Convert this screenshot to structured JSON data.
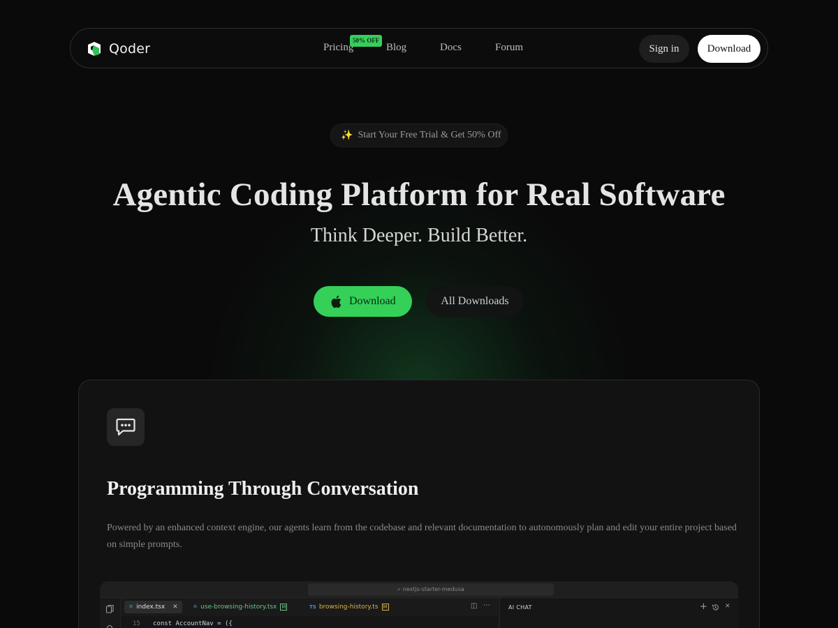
{
  "nav": {
    "brand": "Qoder",
    "links": [
      "Pricing",
      "Blog",
      "Docs",
      "Forum"
    ],
    "pricing_badge": "50% OFF",
    "sign_in": "Sign in",
    "download": "Download"
  },
  "hero": {
    "trial_text": "Start Your Free Trial & Get 50% Off",
    "title": "Agentic Coding Platform for Real Software",
    "subtitle": "Think Deeper. Build Better.",
    "cta_download": "Download",
    "all_downloads": "All Downloads"
  },
  "feature": {
    "icon": "chat-bubble-icon",
    "title": "Programming Through Conversation",
    "description": "Powered by an enhanced context engine, our agents learn from the codebase and relevant documentation to autonomously plan and edit your entire project based on simple prompts."
  },
  "editor": {
    "search": "nextjs-starter-medusa",
    "tabs": [
      {
        "label": "index.tsx",
        "active": true,
        "type": "tsx"
      },
      {
        "label": "use-browsing-history.tsx",
        "active": false,
        "type": "tsx",
        "modified": "M",
        "color": "#6fc38a"
      },
      {
        "label": "browsing-history.ts",
        "active": false,
        "type": "ts",
        "modified": "M",
        "color": "#d9b44a"
      }
    ],
    "line_number": "15",
    "code_line": "const AccountNav = ({",
    "chat_title": "AI CHAT"
  },
  "colors": {
    "accent": "#34d058",
    "background": "#0a0a0a"
  }
}
